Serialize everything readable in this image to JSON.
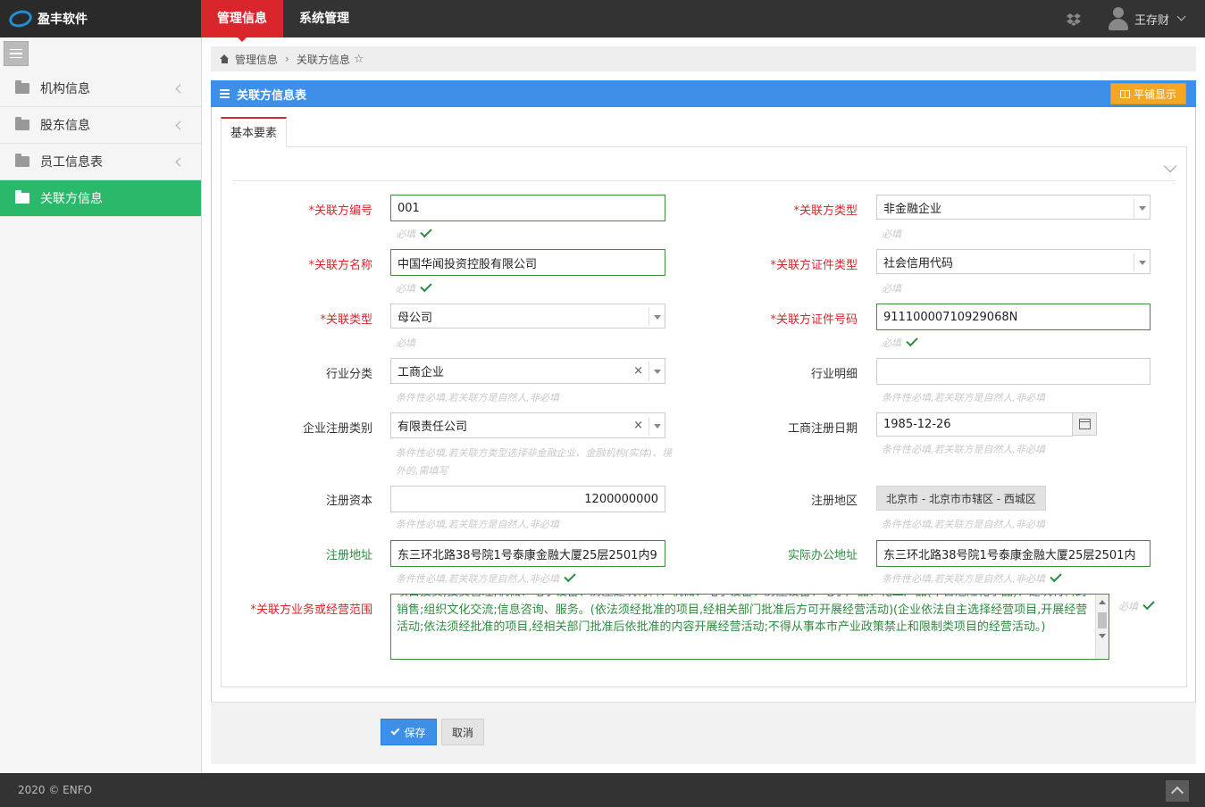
{
  "app": {
    "logo_text": "盈丰软件"
  },
  "topnav": {
    "items": [
      {
        "label": "管理信息",
        "active": true
      },
      {
        "label": "系统管理",
        "active": false
      }
    ]
  },
  "user": {
    "name": "王存财"
  },
  "sidebar": {
    "items": [
      {
        "label": "机构信息",
        "icon": "folder-icon"
      },
      {
        "label": "股东信息",
        "icon": "folder-icon"
      },
      {
        "label": "员工信息表",
        "icon": "folder-icon"
      },
      {
        "label": "关联方信息",
        "icon": "folder-open-icon",
        "active": true
      }
    ]
  },
  "breadcrumb": {
    "home": "管理信息",
    "current": "关联方信息",
    "star": "☆"
  },
  "panel": {
    "title": "关联方信息表",
    "tile_button": "平铺显示",
    "tab": "基本要素"
  },
  "form": {
    "required_mark": "*",
    "related_no": {
      "label": "关联方编号",
      "value": "001",
      "help": "必填"
    },
    "related_type": {
      "label": "关联方类型",
      "value": "非金融企业",
      "help": "必填"
    },
    "related_name": {
      "label": "关联方名称",
      "value": "中国华闻投资控股有限公司",
      "help": "必填"
    },
    "cert_type": {
      "label": "关联方证件类型",
      "value": "社会信用代码",
      "help": "必填"
    },
    "relation_type": {
      "label": "关联类型",
      "value": "母公司",
      "help": "必填"
    },
    "cert_no": {
      "label": "关联方证件号码",
      "value": "91110000710929068N",
      "help": "必填"
    },
    "industry": {
      "label": "行业分类",
      "value": "工商企业",
      "clear": "×",
      "help": "条件性必填,若关联方是自然人,非必填"
    },
    "industry_detail": {
      "label": "行业明细",
      "value": "",
      "help": "条件性必填,若关联方是自然人,非必填"
    },
    "reg_category": {
      "label": "企业注册类别",
      "value": "有限责任公司",
      "clear": "×",
      "help": "条件性必填,若关联方类型选择非金融企业、金融机构(实体)、境外的,需填写"
    },
    "reg_date": {
      "label": "工商注册日期",
      "value": "1985-12-26",
      "help": "条件性必填,若关联方是自然人,非必填"
    },
    "capital": {
      "label": "注册资本",
      "value": "1200000000",
      "help": "条件性必填,若关联方是自然人,非必填"
    },
    "region": {
      "label": "注册地区",
      "value": "北京市 - 北京市市辖区 - 西城区",
      "help": "条件性必填,若关联方是自然人,非必填"
    },
    "reg_address": {
      "label": "注册地址",
      "value": "东三环北路38号院1号泰康金融大厦25层2501内9",
      "help": "条件性必填,若关联方是自然人,非必填"
    },
    "office_address": {
      "label": "实际办公地址",
      "value": "东三环北路38号院1号泰康金融大厦25层2501内",
      "help": "条件性必填,若关联方是自然人,非必填"
    },
    "business_scope": {
      "label": "关联方业务或经营范围",
      "value": "项目投资;投资管理;机械、电子设备、房屋建筑材料、机械、电子设备、房屋设备、电子产品、化工产品(不含危险化学品)、建筑材料的销售;组织文化交流;信息咨询、服务。(依法须经批准的项目,经相关部门批准后方可开展经营活动)(企业依法自主选择经营项目,开展经营活动;依法须经批准的项目,经相关部门批准后依批准的内容开展经营活动;不得从事本市产业政策禁止和限制类项目的经营活动。)",
      "help": "必填"
    }
  },
  "actions": {
    "save": "保存",
    "cancel": "取消"
  },
  "footer": {
    "copyright": "2020 © ENFO"
  }
}
